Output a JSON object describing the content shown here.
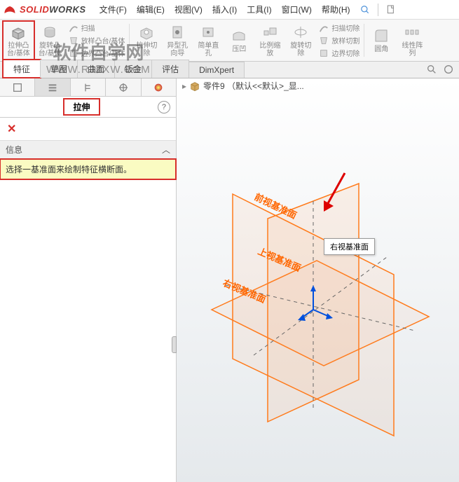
{
  "brand": {
    "name1": "SOLID",
    "name2": "WORKS"
  },
  "menu": {
    "file": "文件(F)",
    "edit": "编辑(E)",
    "view": "视图(V)",
    "insert": "插入(I)",
    "tools": "工具(I)",
    "window": "窗口(W)",
    "help": "帮助(H)"
  },
  "ribbon": {
    "extrude": "拉伸凸\n台/基体",
    "revolve": "旋转凸\n台/基体",
    "sweep": "扫描",
    "loft": "放样凸台/基体",
    "boundary": "边界凸台/基体",
    "extrude_cut": "拉伸切\n除",
    "hole": "异型孔\n向导",
    "revolve_cut": "简单直\n孔",
    "press": "压凹",
    "scale": "比例缩\n放",
    "pattern": "旋转切\n除",
    "dome": "放样切割",
    "sweep_cut": "扫描切除",
    "boundary_cut": "边界切除",
    "fillet": "圆角",
    "linear": "线性阵\n列"
  },
  "tabs": {
    "feature": "特征",
    "sketch": "草图",
    "surface": "曲面",
    "sheetmetal": "钣金",
    "evaluate": "评估",
    "dimxpert": "DimXpert"
  },
  "sidebar": {
    "feature_name": "拉伸",
    "info_label": "信息",
    "info_msg": "选择一基准面来绘制特征横断面。"
  },
  "breadcrumb": {
    "part": "零件9 （默认<<默认>_显..."
  },
  "viewport": {
    "plane_front": "前视基准面",
    "plane_top": "上视基准面",
    "plane_right": "右视基准面",
    "tooltip": "右视基准面"
  },
  "watermark": {
    "line1": "软件自学网",
    "line2": "WWW.RJZXW.COM"
  }
}
